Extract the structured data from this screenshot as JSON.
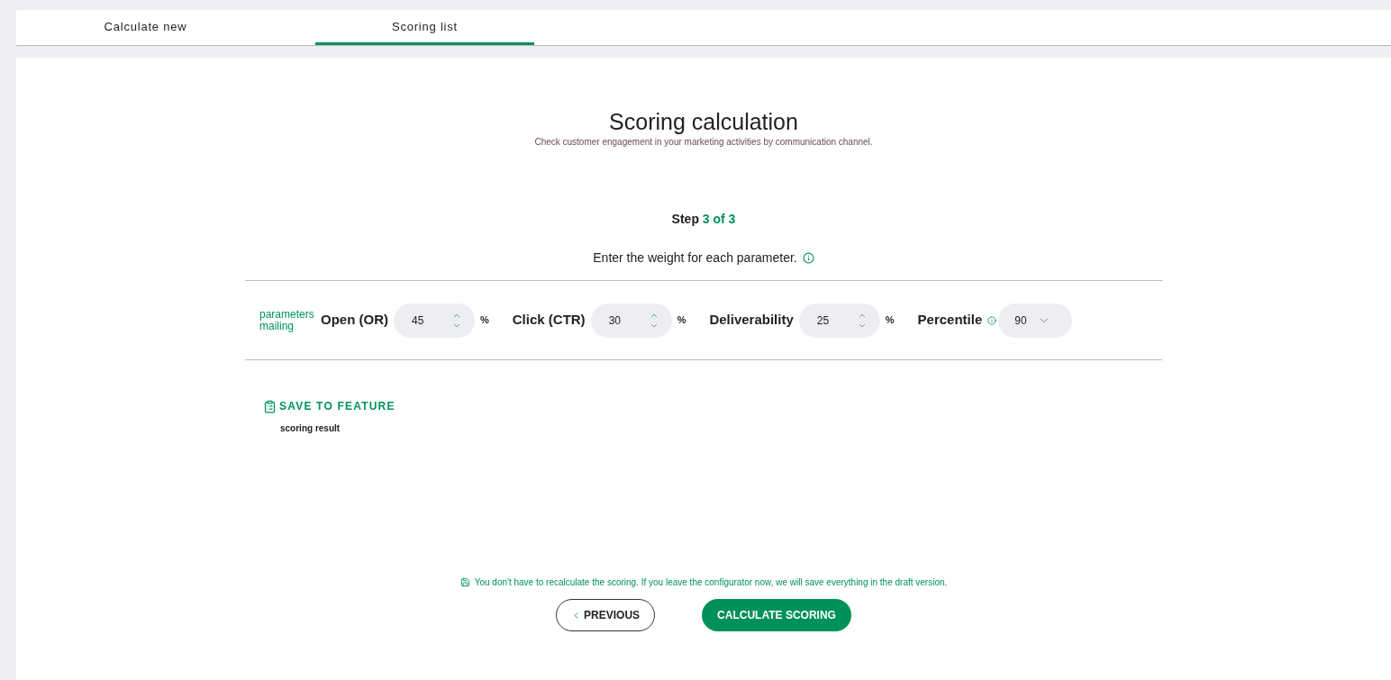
{
  "tabs": [
    {
      "label": "Calculate new",
      "selected": false
    },
    {
      "label": "Scoring list",
      "selected": true
    }
  ],
  "header": {
    "title": "Scoring calculation",
    "subtitle": "Check customer engagement in your marketing activities by communication channel."
  },
  "step": {
    "label": "Step",
    "progress": "3 of 3"
  },
  "instruction": "Enter the weight for each parameter.",
  "group_label": "parameters mailing",
  "parameters": [
    {
      "kind": "spinner",
      "label": "Open (OR)",
      "value": "45",
      "unit": "%"
    },
    {
      "kind": "spinner",
      "label": "Click (CTR)",
      "value": "30",
      "unit": "%"
    },
    {
      "kind": "spinner",
      "label": "Deliverability",
      "value": "25",
      "unit": "%"
    },
    {
      "kind": "select",
      "label": "Percentile",
      "value": "90",
      "info": true
    }
  ],
  "save": {
    "link": "SAVE TO FEATURE",
    "caption": "scoring result"
  },
  "draft_note": "You don't have to recalculate the scoring. If you leave the configurator now, we will save everything in the draft version.",
  "buttons": [
    {
      "kind": "secondary",
      "label": "PREVIOUS"
    },
    {
      "kind": "primary",
      "label": "CALCULATE SCORING"
    }
  ]
}
